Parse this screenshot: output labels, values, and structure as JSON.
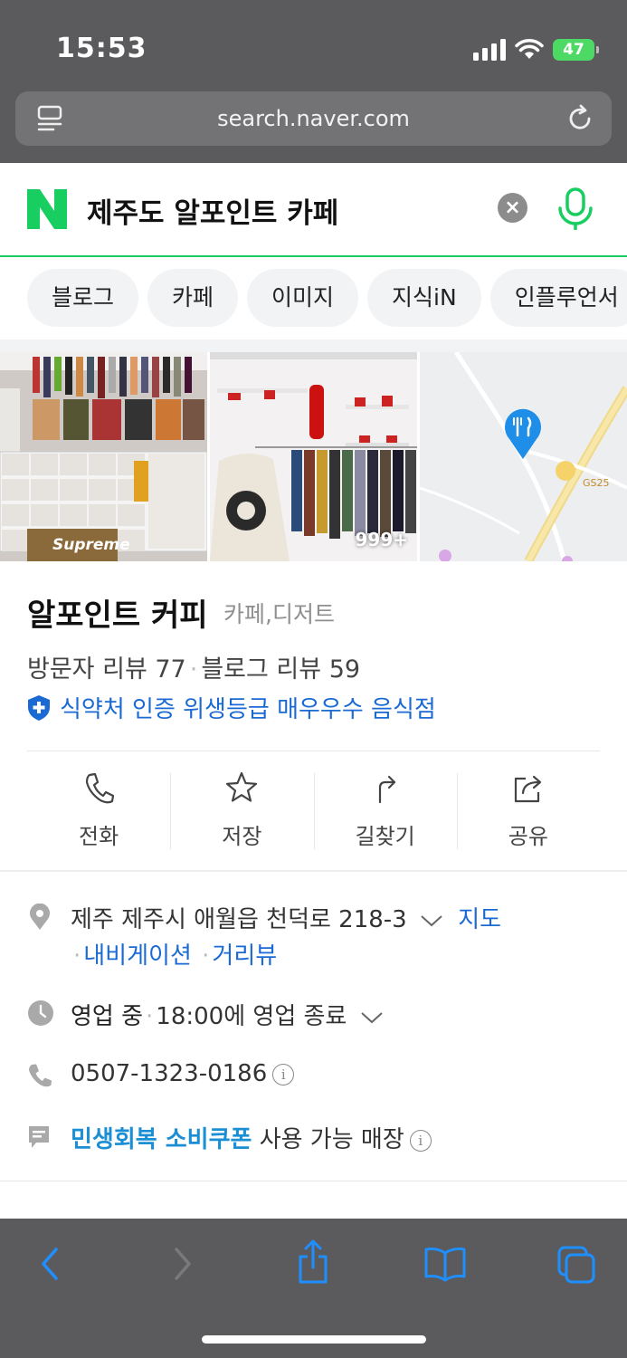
{
  "status_bar": {
    "time": "15:53",
    "battery": "47"
  },
  "browser": {
    "url": "search.naver.com"
  },
  "search": {
    "logo": "N",
    "query": "제주도 알포인트 카페",
    "clear_label": "×"
  },
  "chips": [
    "블로그",
    "카페",
    "이미지",
    "지식iN",
    "인플루언서"
  ],
  "photos": {
    "tag": "Supreme",
    "count": "999+",
    "map_label": "GS25"
  },
  "place": {
    "name": "알포인트 커피",
    "category": "카페,디저트",
    "visitor_reviews": "방문자 리뷰 77",
    "blog_reviews": "블로그 리뷰 59",
    "hygiene": "식약처 인증 위생등급 매우우수 음식점"
  },
  "actions": [
    {
      "label": "전화",
      "icon": "phone-icon"
    },
    {
      "label": "저장",
      "icon": "star-icon"
    },
    {
      "label": "길찾기",
      "icon": "directions-icon"
    },
    {
      "label": "공유",
      "icon": "share-icon"
    }
  ],
  "details": {
    "address": "제주 제주시 애월읍 천덕로 218-3",
    "map_link": "지도",
    "navigation_link": "내비게이션",
    "streetview_link": "거리뷰",
    "status": "영업 중",
    "hours": "18:00에 영업 종료",
    "phone": "0507-1323-0186",
    "coupon_highlight": "민생회복 소비쿠폰",
    "coupon_text": "사용 가능 매장"
  },
  "colors": {
    "naver_green": "#19ce60",
    "link_blue": "#1b6ad4",
    "chrome_gray": "#5b5b5d"
  }
}
